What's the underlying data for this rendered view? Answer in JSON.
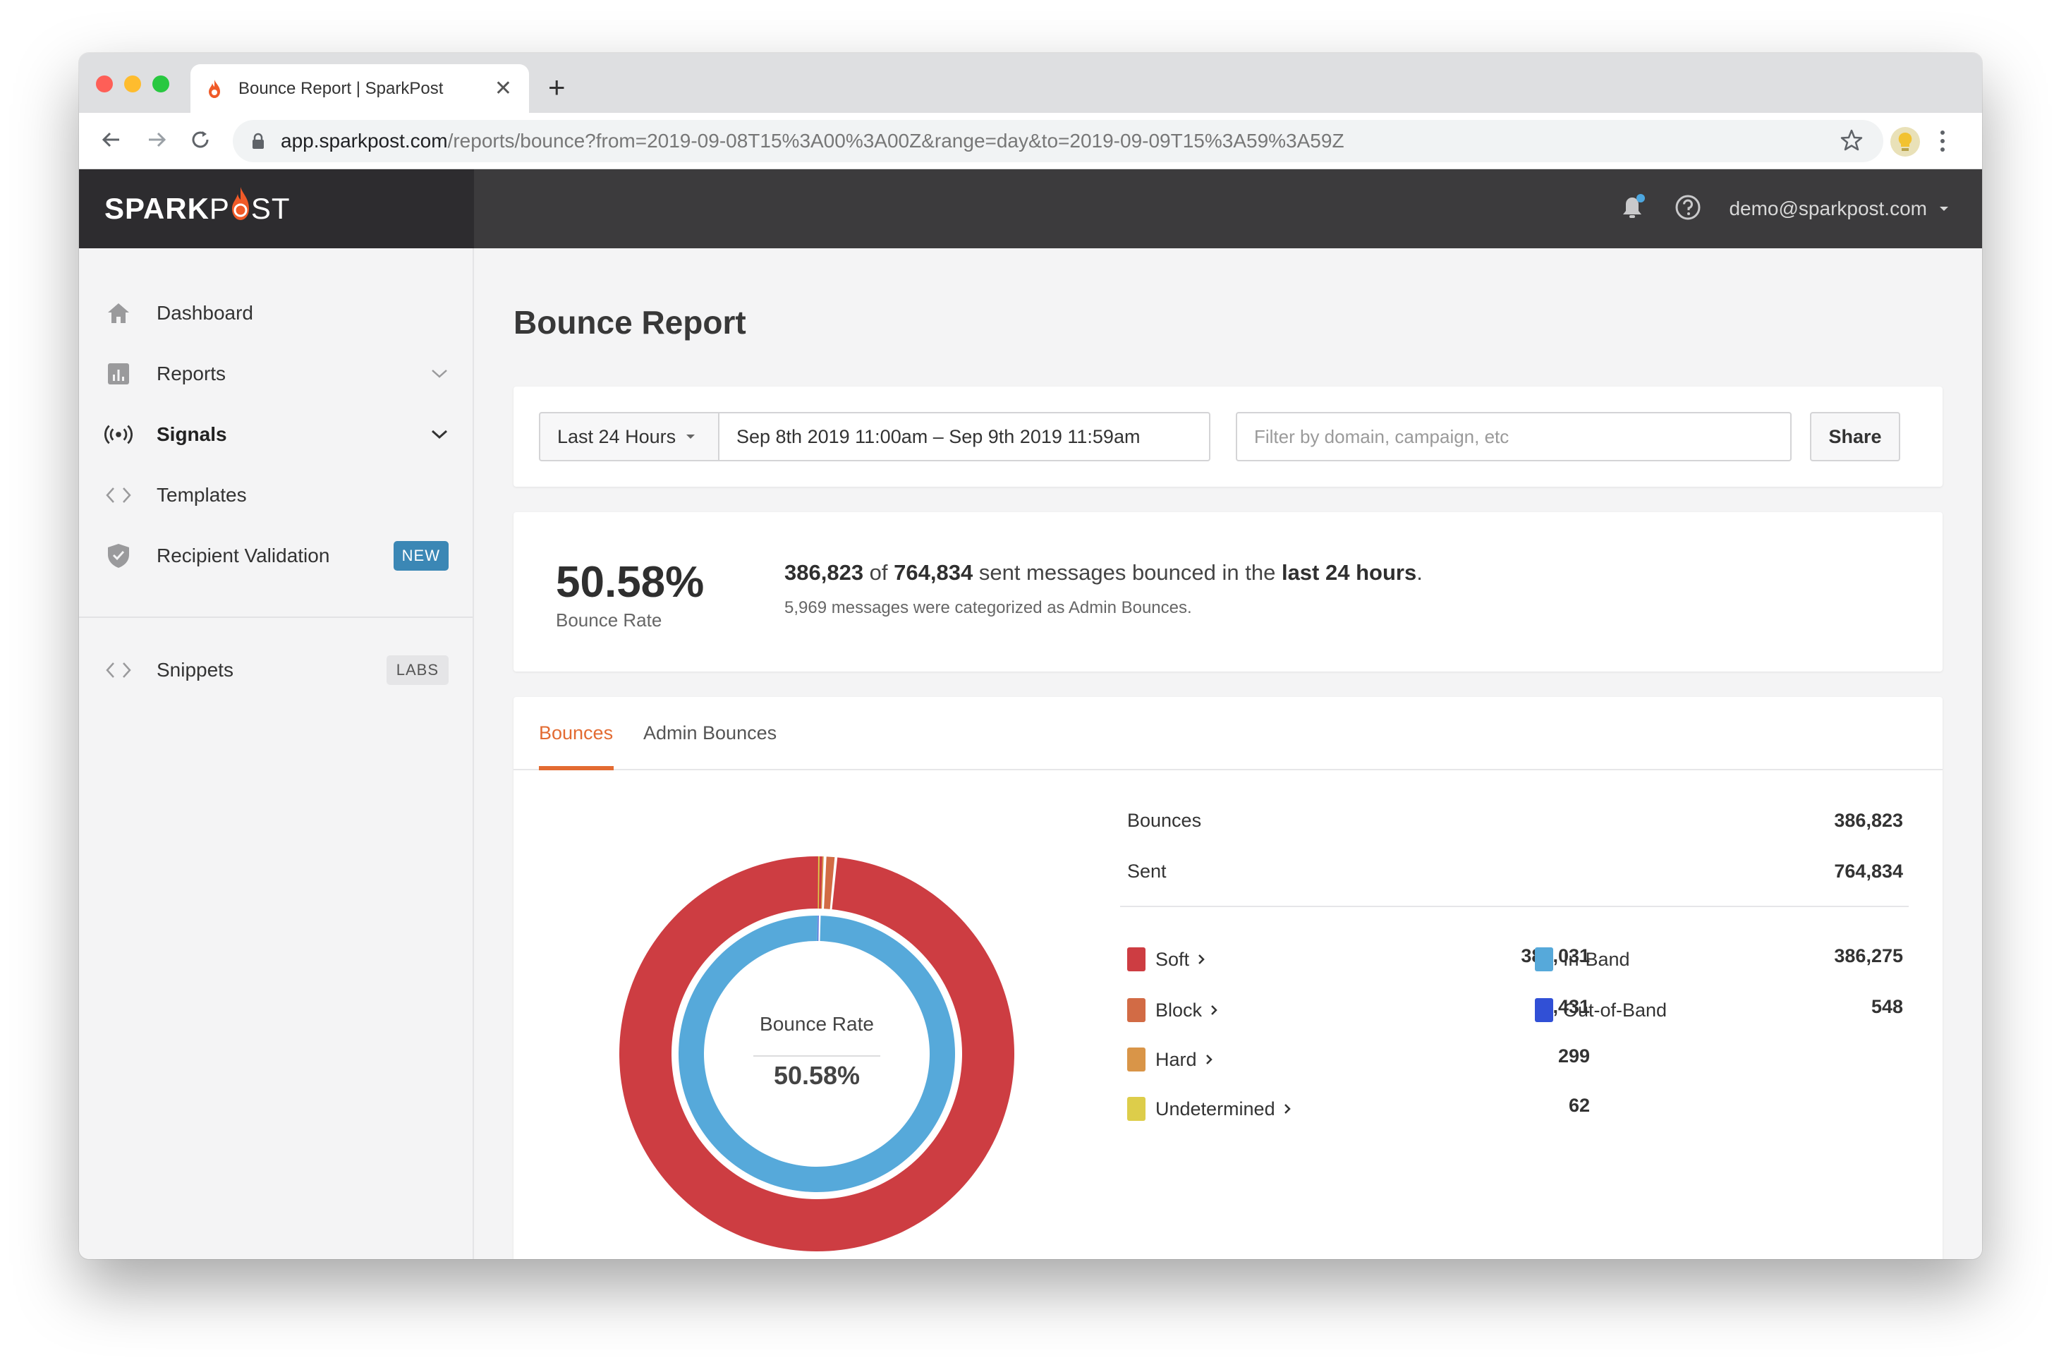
{
  "browser": {
    "tab_title": "Bounce Report | SparkPost",
    "url_host": "app.sparkpost.com",
    "url_path": "/reports/bounce?from=2019-09-08T15%3A00%3A00Z&range=day&to=2019-09-09T15%3A59%3A59Z"
  },
  "header": {
    "logo_spark": "SPARK",
    "logo_post_p": "P",
    "logo_post_rest": "ST",
    "user_email": "demo@sparkpost.com"
  },
  "sidebar": {
    "items": [
      {
        "label": "Dashboard",
        "icon": "home-icon"
      },
      {
        "label": "Reports",
        "icon": "bar-chart-icon"
      },
      {
        "label": "Signals",
        "icon": "signal-icon"
      },
      {
        "label": "Templates",
        "icon": "code-icon"
      },
      {
        "label": "Recipient Validation",
        "icon": "shield-check-icon",
        "badge": "NEW"
      },
      {
        "label": "Snippets",
        "icon": "code-icon",
        "badge": "LABS"
      }
    ]
  },
  "main": {
    "title": "Bounce Report",
    "filter": {
      "range_label": "Last 24 Hours",
      "date_range": "Sep 8th 2019 11:00am – Sep 9th 2019 11:59am",
      "search_placeholder": "Filter by domain, campaign, etc",
      "share_label": "Share"
    },
    "summary": {
      "rate": "50.58%",
      "rate_caption": "Bounce Rate",
      "bounced": "386,823",
      "of_text": " of ",
      "sent": "764,834",
      "mid_text": " sent messages bounced in the ",
      "period": "last 24 hours",
      "end_text": ".",
      "admin_note": "5,969 messages were categorized as Admin Bounces."
    },
    "tabs": [
      "Bounces",
      "Admin Bounces"
    ],
    "donut": {
      "center_label": "Bounce Rate",
      "center_value": "50.58%"
    },
    "totals": [
      {
        "label": "Bounces",
        "value": "386,823"
      },
      {
        "label": "Sent",
        "value": "764,834"
      }
    ],
    "classification": [
      {
        "label": "Soft",
        "value": "383,031",
        "color": "#cd3d42"
      },
      {
        "label": "Block",
        "value": "3,431",
        "color": "#d26b45"
      },
      {
        "label": "Hard",
        "value": "299",
        "color": "#d99548"
      },
      {
        "label": "Undetermined",
        "value": "62",
        "color": "#ddcd4a"
      }
    ],
    "bands": [
      {
        "label": "In-Band",
        "value": "386,275",
        "color": "#56a9da"
      },
      {
        "label": "Out-of-Band",
        "value": "548",
        "color": "#3150d6"
      }
    ]
  },
  "colors": {
    "accent": "#e36b32",
    "header_bg": "#3c3b3d",
    "badge_new": "#3b87b5"
  }
}
